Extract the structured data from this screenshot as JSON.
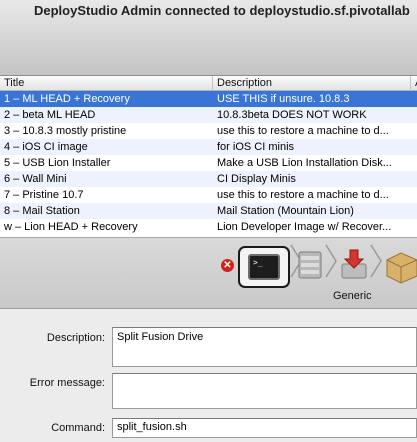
{
  "window": {
    "title": "DeployStudio Admin connected to deploystudio.sf.pivotallab"
  },
  "table": {
    "columns": [
      "Title",
      "Description",
      "A"
    ],
    "rows": [
      {
        "title": "1 – ML HEAD + Recovery",
        "description": "USE THIS if unsure. 10.8.3",
        "selected": true
      },
      {
        "title": "2 – beta ML HEAD",
        "description": "10.8.3beta DOES NOT WORK"
      },
      {
        "title": "3 – 10.8.3 mostly pristine",
        "description": "use this to restore a machine to d..."
      },
      {
        "title": "4 – iOS CI image",
        "description": "for iOS CI minis"
      },
      {
        "title": "5 – USB Lion Installer",
        "description": "Make a USB Lion Installation Disk..."
      },
      {
        "title": "6 – Wall Mini",
        "description": "CI Display Minis"
      },
      {
        "title": "7 – Pristine 10.7",
        "description": "use this to restore a machine to d..."
      },
      {
        "title": "8 – Mail Station",
        "description": "Mail Station (Mountain Lion)"
      },
      {
        "title": "w – Lion HEAD + Recovery",
        "description": "Lion Developer Image w/ Recover..."
      }
    ]
  },
  "workflow": {
    "delete_glyph": "✕",
    "terminal_prompt": ">_",
    "selected_task_label": "Generic",
    "task_icons": [
      "terminal-icon",
      "disk-icon",
      "download-disk-icon",
      "package-icon"
    ]
  },
  "form": {
    "description_label": "Description:",
    "description_value": "Split Fusion Drive",
    "error_label": "Error message:",
    "error_value": "",
    "command_label": "Command:",
    "command_value": "split_fusion.sh"
  },
  "colors": {
    "selection": "#3875d7",
    "alt_row": "#edf3fe",
    "delete": "#c9251e"
  }
}
